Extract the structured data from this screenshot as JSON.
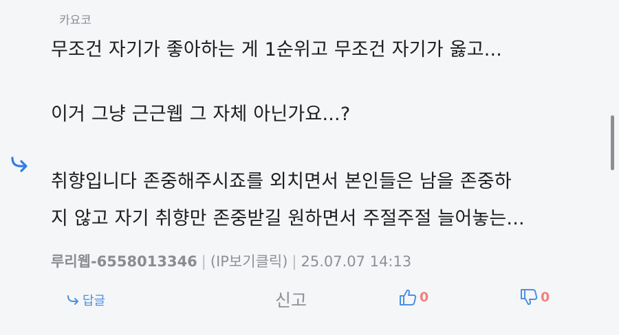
{
  "comment_top": {
    "label": "카요코"
  },
  "comment": {
    "lines": {
      "l1": "무조건 자기가 좋아하는 게 1순위고 무조건 자기가 옳고...",
      "l2": "이거 그냥 근근웹 그 자체 아닌가요...?",
      "l3": "취향입니다 존중해주시죠를 외치면서 본인들은 남을 존중하",
      "l4": "지 않고 자기 취향만 존중받길 원하면서 주절주절 늘어놓는..."
    },
    "icon": "reply-indicator-icon"
  },
  "meta": {
    "author": "루리웹-6558013346",
    "ip": "(IP보기클릭)",
    "timestamp": "25.07.07 14:13",
    "separator": "|"
  },
  "actions": {
    "reply_label": "답글",
    "report_label": "신고",
    "like_count": "0",
    "dislike_count": "0",
    "like_icon": "thumbs-up-icon",
    "dislike_icon": "thumbs-down-icon"
  },
  "colors": {
    "background": "#f5f6f8",
    "text": "#1d1d1f",
    "muted": "#8d9096",
    "accent": "#4a8fe0",
    "count": "#f08080"
  }
}
